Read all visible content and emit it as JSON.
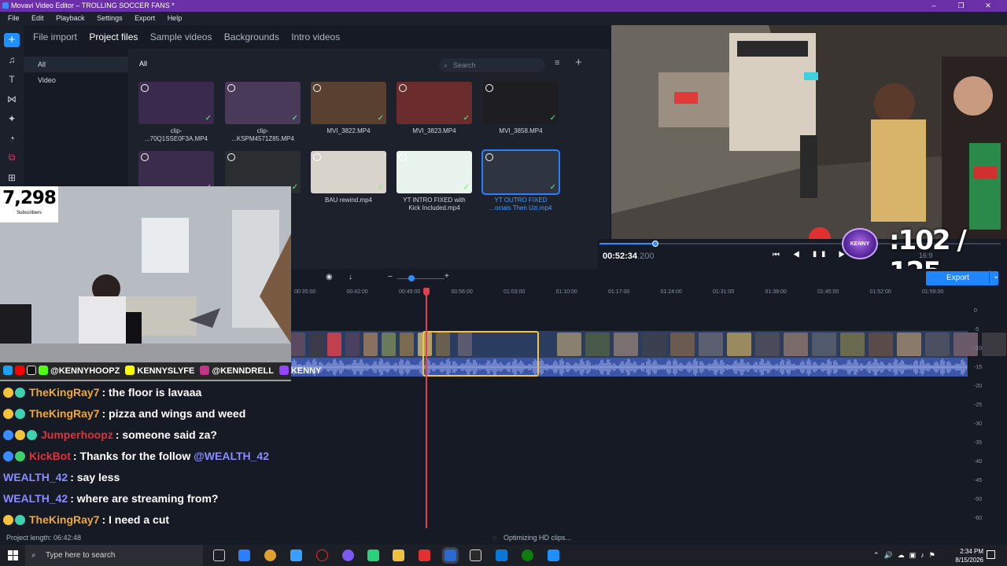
{
  "window": {
    "title": "Movavi Video Editor – TROLLING SOCCER FANS *",
    "controls": [
      "–",
      "❐",
      "✕"
    ]
  },
  "menu": [
    "File",
    "Edit",
    "Playback",
    "Settings",
    "Export",
    "Help"
  ],
  "tools": [
    "+",
    "♫",
    "T",
    "⋈",
    "✦",
    "◔",
    "⧉",
    "⊞"
  ],
  "tabs": [
    "File import",
    "Project files",
    "Sample videos",
    "Backgrounds",
    "Intro videos"
  ],
  "active_tab": "Project files",
  "categories": [
    "All",
    "Video"
  ],
  "media": {
    "header": "All",
    "search_placeholder": "Search",
    "sort_icon": "≡",
    "add_icon": "+",
    "clips": [
      {
        "label": "clip-\n...70Q1SSE0F3A.MP4",
        "color": "#3a2a4e"
      },
      {
        "label": "clip-\n...KSPM4571Z85.MP4",
        "color": "#4a3a5a"
      },
      {
        "label": "MVI_3822.MP4",
        "color": "#5a4030"
      },
      {
        "label": "MVI_3823.MP4",
        "color": "#6a2c2c"
      },
      {
        "label": "MVI_3858.MP4",
        "color": "#1e1e22"
      },
      {
        "label": "",
        "color": "#3a2c4a"
      },
      {
        "label": "",
        "color": "#2a2e30"
      },
      {
        "label": "BAU rewind.mp4",
        "color": "#d8d4cc"
      },
      {
        "label": "YT INTRO FIXED with\nKick Included.mp4",
        "color": "#e8f4ec"
      },
      {
        "label": "YT OUTRO FIXED\n...ocials Then Uzi.mp4",
        "color": "#2e3440"
      }
    ]
  },
  "player": {
    "time": "00:52:34",
    "time_ms": ".200",
    "progress": 0.14,
    "controls": "⏮ ◀ ❚❚ ▶ ⏭",
    "aspect": "16:9",
    "counter": ":102 / 125",
    "counter_logo": "KENNY"
  },
  "timeline": {
    "tools": [
      "◉",
      "↓",
      "−",
      "+"
    ],
    "zoom": 0.3,
    "export_label": "Export",
    "export_arrow": "⌄",
    "ruler": [
      "00:35:00",
      "00:42:00",
      "00:49:00",
      "00:56:00",
      "01:03:00",
      "01:10:00",
      "01:17:00",
      "01:24:00",
      "01:31:00",
      "01:38:00",
      "01:45:00",
      "01:52:00",
      "01:59:00"
    ],
    "meter": [
      "0",
      "-5",
      "-10",
      "-15",
      "-20",
      "-25",
      "-30",
      "-35",
      "-40",
      "-45",
      "-50",
      "-60"
    ]
  },
  "overlay": {
    "subscribers": "7,298",
    "subscribers_label": "Subscribers",
    "socials": [
      "@KENNYHOOPZ",
      "KENNYSLYFE",
      "@KENNDRELL",
      "KENNY"
    ]
  },
  "chat": [
    {
      "user": "TheKingRay7",
      "color": "#f0a83a",
      "msg": ": the floor is lavaaa",
      "badges": [
        "#f3c33c",
        "#3fd0b0"
      ]
    },
    {
      "user": "TheKingRay7",
      "color": "#f0a83a",
      "msg": ": pizza and wings and weed",
      "badges": [
        "#f3c33c",
        "#3fd0b0"
      ]
    },
    {
      "user": "Jumperhoopz",
      "color": "#e0323c",
      "msg": ": someone said za?",
      "badges": [
        "#3a8bff",
        "#f3c33c",
        "#3fd0b0"
      ]
    },
    {
      "user": "KickBot",
      "color": "#e0323c",
      "msg": ": Thanks for the follow ",
      "mention": "@WEALTH_42",
      "badges": [
        "#3a8bff",
        "#3fd06a"
      ]
    },
    {
      "user": "WEALTH_42",
      "color": "#8a8cff",
      "msg": ": say less",
      "badges": []
    },
    {
      "user": "WEALTH_42",
      "color": "#8a8cff",
      "msg": ": where are streaming from?",
      "badges": []
    },
    {
      "user": "TheKingRay7",
      "color": "#f0a83a",
      "msg": ": I need a cut",
      "badges": [
        "#f3c33c",
        "#3fd0b0"
      ]
    }
  ],
  "status": {
    "project_length": "Project length: 06:42:48",
    "optimizing": "Optimizing HD clips..."
  },
  "taskbar": {
    "search": "Type here to search",
    "time": "2:34 PM",
    "date": "8/15/2026"
  }
}
